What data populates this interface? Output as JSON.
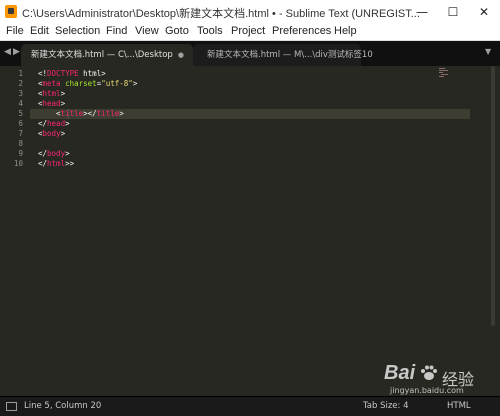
{
  "window": {
    "title": "C:\\Users\\Administrator\\Desktop\\新建文本文档.html • - Sublime Text (UNREGIST...",
    "minimize_glyph": "—",
    "maximize_glyph": "☐",
    "close_glyph": "✕"
  },
  "menu": [
    "File",
    "Edit",
    "Selection",
    "Find",
    "View",
    "Goto",
    "Tools",
    "Project",
    "Preferences",
    "Help"
  ],
  "tabs": {
    "nav_left": "◀",
    "nav_right": "▶",
    "active": {
      "label": "新建文本文档.html — C\\...\\Desktop",
      "dirty_marker": "●"
    },
    "inactive": {
      "label": "新建文本文档.html — M\\...\\div测试标签10"
    },
    "dropdown": "▼"
  },
  "editor": {
    "line_numbers": [
      "1",
      "2",
      "3",
      "4",
      "5",
      "6",
      "7",
      "8",
      "9",
      "10"
    ],
    "lines": [
      [
        {
          "t": "<!",
          "c": "plain"
        },
        {
          "t": "DOCTYPE",
          "c": "tag"
        },
        {
          "t": " html>",
          "c": "plain"
        }
      ],
      [
        {
          "t": "<",
          "c": "plain"
        },
        {
          "t": "meta",
          "c": "tag"
        },
        {
          "t": " ",
          "c": "plain"
        },
        {
          "t": "charset",
          "c": "attr"
        },
        {
          "t": "=",
          "c": "plain"
        },
        {
          "t": "\"utf-8\"",
          "c": "str"
        },
        {
          "t": ">",
          "c": "plain"
        }
      ],
      [
        {
          "t": "<",
          "c": "plain"
        },
        {
          "t": "html",
          "c": "tag"
        },
        {
          "t": ">",
          "c": "plain"
        }
      ],
      [
        {
          "t": "<",
          "c": "plain"
        },
        {
          "t": "head",
          "c": "tag"
        },
        {
          "t": ">",
          "c": "plain"
        }
      ],
      [
        {
          "t": "    <",
          "c": "plain"
        },
        {
          "t": "title",
          "c": "tag"
        },
        {
          "t": "></",
          "c": "plain"
        },
        {
          "t": "title",
          "c": "tag"
        },
        {
          "t": ">",
          "c": "plain"
        }
      ],
      [
        {
          "t": "</",
          "c": "plain"
        },
        {
          "t": "head",
          "c": "tag"
        },
        {
          "t": ">",
          "c": "plain"
        }
      ],
      [
        {
          "t": "<",
          "c": "plain"
        },
        {
          "t": "body",
          "c": "tag"
        },
        {
          "t": ">",
          "c": "plain"
        }
      ],
      [],
      [
        {
          "t": "</",
          "c": "plain"
        },
        {
          "t": "body",
          "c": "tag"
        },
        {
          "t": ">",
          "c": "plain"
        }
      ],
      [
        {
          "t": "</",
          "c": "plain"
        },
        {
          "t": "html",
          "c": "tag"
        },
        {
          "t": ">>",
          "c": "plain"
        }
      ]
    ],
    "current_line": 5
  },
  "status": {
    "position": "Line 5, Column 20",
    "tab_size": "Tab Size: 4",
    "syntax": "HTML"
  },
  "watermark": {
    "logo": "Bai",
    "cn": "经验",
    "url": "jingyan.baidu.com"
  },
  "colors": {
    "tag": "#f92672",
    "attr": "#a6e22e",
    "string": "#e6db74",
    "plain": "#f8f8f2",
    "background": "#272822"
  }
}
